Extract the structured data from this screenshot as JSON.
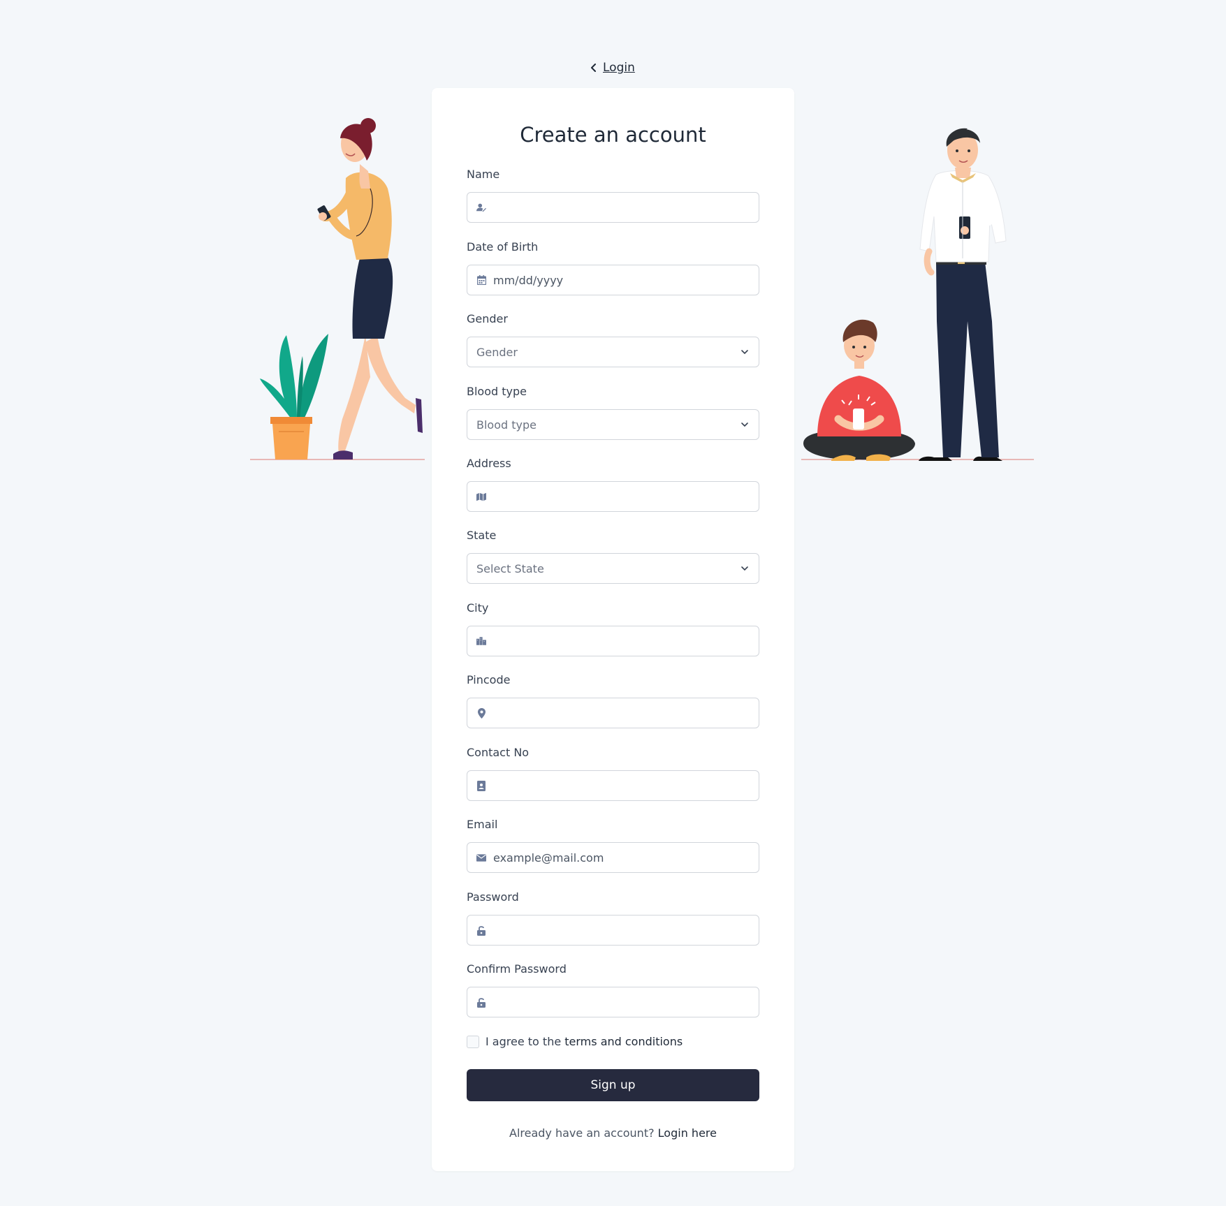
{
  "nav": {
    "back_label": "Login"
  },
  "form": {
    "title": "Create an account",
    "fields": {
      "name": {
        "label": "Name",
        "placeholder": ""
      },
      "dob": {
        "label": "Date of Birth",
        "placeholder": "mm/dd/yyyy"
      },
      "gender": {
        "label": "Gender",
        "value": "Gender"
      },
      "blood": {
        "label": "Blood type",
        "value": "Blood type"
      },
      "address": {
        "label": "Address",
        "placeholder": ""
      },
      "state": {
        "label": "State",
        "value": "Select State"
      },
      "city": {
        "label": "City",
        "placeholder": ""
      },
      "pincode": {
        "label": "Pincode",
        "placeholder": ""
      },
      "contact": {
        "label": "Contact No",
        "placeholder": ""
      },
      "email": {
        "label": "Email",
        "placeholder": "example@mail.com"
      },
      "password": {
        "label": "Password",
        "placeholder": ""
      },
      "confirm": {
        "label": "Confirm Password",
        "placeholder": ""
      }
    },
    "terms": {
      "prefix": "I agree to the ",
      "link": "terms and conditions",
      "checked": false
    },
    "submit_label": "Sign up",
    "footer": {
      "text": "Already have an account? ",
      "link": "Login here"
    }
  },
  "icons": {
    "name": "user-edit-icon",
    "dob": "calendar-icon",
    "address": "map-icon",
    "city": "city-icon",
    "pincode": "map-pin-icon",
    "contact": "contact-card-icon",
    "email": "envelope-icon",
    "password": "unlock-icon",
    "select": "chevron-down-icon",
    "back": "chevron-left-icon"
  },
  "colors": {
    "page_bg": "#f4f7fa",
    "card_bg": "#ffffff",
    "button_bg": "#262a3e",
    "input_border": "#d1d5db",
    "icon": "#6b7a99"
  }
}
